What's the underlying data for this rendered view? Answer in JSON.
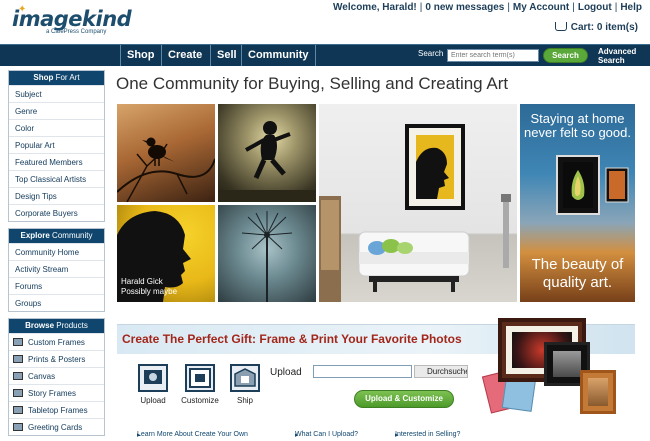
{
  "logo": {
    "name": "imagekind",
    "tagline": "a CafePress Company"
  },
  "topnav": {
    "welcome": "Welcome, Harald!",
    "messages": "0 new messages",
    "account": "My Account",
    "logout": "Logout",
    "help": "Help",
    "cart": "Cart: 0 item(s)"
  },
  "navbar": {
    "items": [
      "Shop",
      "Create",
      "Sell",
      "Community"
    ],
    "search_label": "Search",
    "search_placeholder": "Enter search term(s)",
    "search_button": "Search",
    "advanced_search": "Advanced Search"
  },
  "sidebar": {
    "shop": {
      "title_bold": "Shop",
      "title_rest": " For Art",
      "items": [
        "Subject",
        "Genre",
        "Color",
        "Popular Art",
        "Featured Members",
        "Top Classical Artists",
        "Design Tips",
        "Corporate Buyers"
      ]
    },
    "explore": {
      "title_bold": "Explore",
      "title_rest": " Community",
      "items": [
        "Community Home",
        "Activity Stream",
        "Forums",
        "Groups"
      ]
    },
    "browse": {
      "title_bold": "Browse",
      "title_rest": " Products",
      "items": [
        "Custom Frames",
        "Prints & Posters",
        "Canvas",
        "Story Frames",
        "Tabletop Frames",
        "Greeting Cards"
      ]
    }
  },
  "main": {
    "title": "One Community for Buying, Selling and Creating Art",
    "tile_caption_line1": "Harald Gick",
    "tile_caption_line2": "Possibly maybe",
    "promo_top": "Staying at home never felt so good.",
    "promo_bottom": "The beauty of quality art."
  },
  "gift": {
    "title": "Create The Perfect Gift: Frame & Print Your Favorite Photos",
    "steps": [
      "Upload",
      "Customize",
      "Ship"
    ],
    "upload_label": "Upload",
    "browse_button": "Durchsuchen...",
    "upload_customize_button": "Upload & Customize"
  },
  "links": [
    "Learn More About Create Your Own",
    "What Can I Upload?",
    "Interested in Selling?"
  ],
  "colors": {
    "navbar": "#0f3654",
    "accent_green": "#5aa83a",
    "gift_title": "#a3261b"
  }
}
